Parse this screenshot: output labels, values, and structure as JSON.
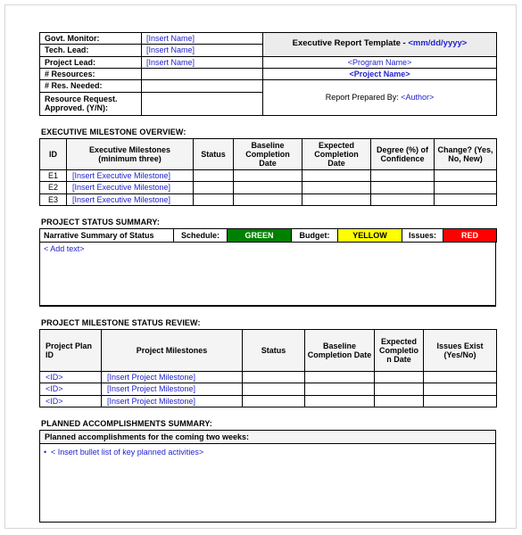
{
  "header": {
    "rows": [
      {
        "label": "Govt. Monitor:",
        "value": "[Insert Name]"
      },
      {
        "label": "Tech. Lead:",
        "value": "[Insert Name]"
      },
      {
        "label": "Project Lead:",
        "value": "[Insert Name]"
      },
      {
        "label": "# Resources:",
        "value": ""
      },
      {
        "label": "# Res. Needed:",
        "value": ""
      },
      {
        "label": "Resource Request. Approved. (Y/N):",
        "value": ""
      }
    ],
    "title_prefix": "Executive Report Template - ",
    "title_date": "<mm/dd/yyyy>",
    "program_name": "<Program Name>",
    "project_name": "<Project Name>",
    "prepared_by_label": "Report Prepared By: ",
    "author": "<Author>"
  },
  "exec_milestone": {
    "caption": "EXECUTIVE MILESTONE OVERVIEW:",
    "columns": [
      "ID",
      "Executive Milestones (minimum three)",
      "Status",
      "Baseline Completion Date",
      "Expected Completion Date",
      "Degree (%) of Confidence",
      "Change? (Yes, No, New)"
    ],
    "col_lines": {
      "c0": "ID",
      "c1a": "Executive Milestones",
      "c1b": "(minimum three)",
      "c2": "Status",
      "c3a": "Baseline",
      "c3b": "Completion",
      "c3c": "Date",
      "c4a": "Expected",
      "c4b": "Completion",
      "c4c": "Date",
      "c5a": "Degree (%) of",
      "c5b": "Confidence",
      "c6a": "Change? (Yes,",
      "c6b": "No, New)"
    },
    "rows": [
      {
        "id": "E1",
        "milestone": "[Insert Executive Milestone]",
        "status": "",
        "baseline": "",
        "expected": "",
        "confidence": "",
        "change": ""
      },
      {
        "id": "E2",
        "milestone": "[Insert Executive Milestone]",
        "status": "",
        "baseline": "",
        "expected": "",
        "confidence": "",
        "change": ""
      },
      {
        "id": "E3",
        "milestone": "[Insert Executive Milestone]",
        "status": "",
        "baseline": "",
        "expected": "",
        "confidence": "",
        "change": ""
      }
    ]
  },
  "project_status": {
    "caption": "PROJECT STATUS SUMMARY:",
    "narrative_header": "Narrative Summary of Status",
    "indicators": [
      {
        "label": "Schedule:",
        "value": "GREEN",
        "bg": "#008000",
        "fg": "#ffffff"
      },
      {
        "label": "Budget:",
        "value": "YELLOW",
        "bg": "#ffff00",
        "fg": "#000000"
      },
      {
        "label": "Issues:",
        "value": "RED",
        "bg": "#ff0000",
        "fg": "#ffffff"
      }
    ],
    "narrative_text": "< Add text>"
  },
  "milestone_review": {
    "caption": "PROJECT MILESTONE STATUS REVIEW:",
    "columns": [
      "Project Plan ID",
      "Project Milestones",
      "Status",
      "Baseline Completion Date",
      "Expected Completion Date",
      "Issues Exist (Yes/No)"
    ],
    "col_lines": {
      "c0a": "Project Plan",
      "c0b": "ID",
      "c1": "Project Milestones",
      "c2": "Status",
      "c3a": "Baseline",
      "c3b": "Completion Date",
      "c4a": "Expected",
      "c4b": "Completio",
      "c4c": "n Date",
      "c5a": "Issues Exist",
      "c5b": "(Yes/No)"
    },
    "rows": [
      {
        "id": "<ID>",
        "milestone": "[Insert Project Milestone]",
        "status": "",
        "baseline": "",
        "expected": "",
        "issues": ""
      },
      {
        "id": "<ID>",
        "milestone": "[Insert Project Milestone]",
        "status": "",
        "baseline": "",
        "expected": "",
        "issues": ""
      },
      {
        "id": "<ID>",
        "milestone": "[Insert Project Milestone]",
        "status": "",
        "baseline": "",
        "expected": "",
        "issues": ""
      }
    ]
  },
  "planned": {
    "caption": "PLANNED ACCOMPLISHMENTS SUMMARY:",
    "header": "Planned accomplishments for the coming two weeks:",
    "bullet_glyph": "•",
    "bullet_text": "< Insert bullet list of key planned activities>"
  }
}
